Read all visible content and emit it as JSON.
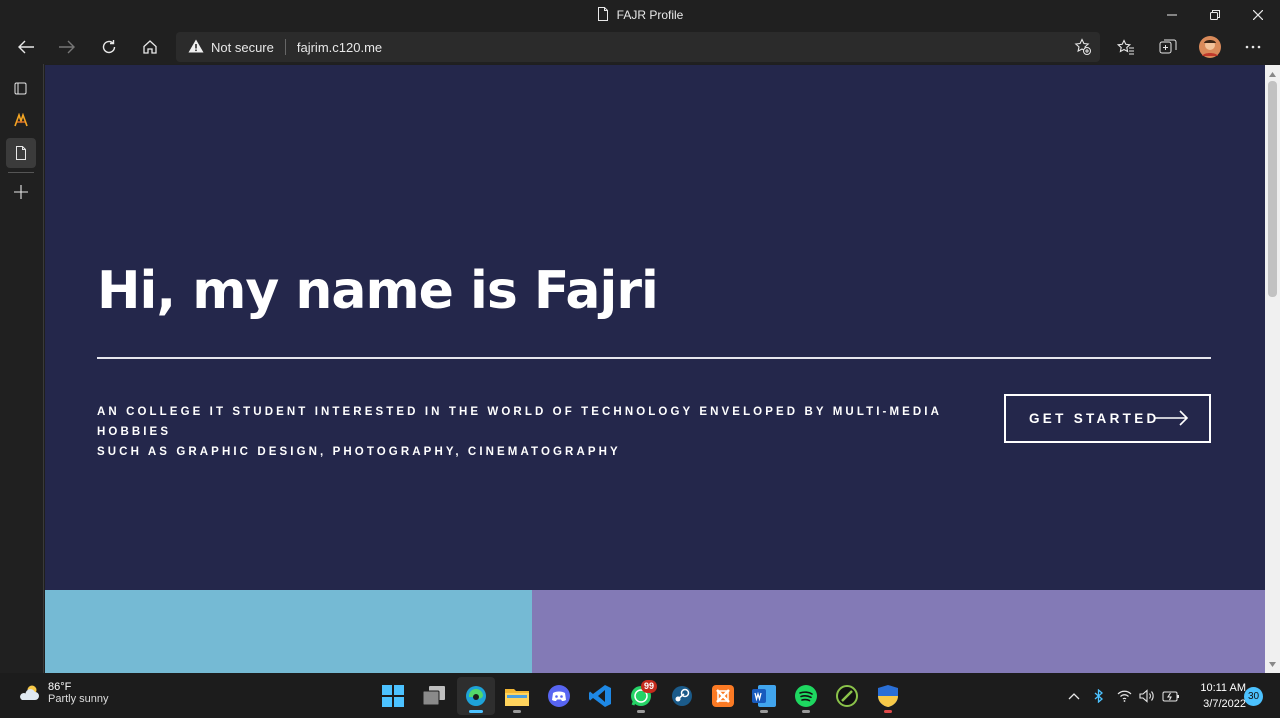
{
  "window": {
    "title": "FAJR Profile"
  },
  "address_bar": {
    "security_label": "Not secure",
    "url": "fajrim.c120.me"
  },
  "hero": {
    "title": "Hi, my name is Fajri",
    "description_line1": "AN COLLEGE IT STUDENT INTERESTED IN THE WORLD OF TECHNOLOGY ENVELOPED BY MULTI-MEDIA HOBBIES",
    "description_line2": "SUCH AS GRAPHIC DESIGN, PHOTOGRAPHY, CINEMATOGRAPHY",
    "cta_label": "GET STARTED"
  },
  "colors": {
    "hero_bg": "#24274b",
    "panel_blue": "#75bad4",
    "panel_purple": "#837ab6",
    "accent": "#4cc2ff"
  },
  "taskbar": {
    "weather_temp": "86°F",
    "weather_desc": "Partly sunny",
    "whatsapp_badge": "99",
    "time": "10:11 AM",
    "date": "3/7/2022",
    "notification_count": "30",
    "apps": [
      "start-icon",
      "task-view-icon",
      "edge-icon",
      "file-explorer-icon",
      "discord-icon",
      "vscode-icon",
      "whatsapp-icon",
      "steam-icon",
      "xampp-icon",
      "word-icon",
      "spotify-icon",
      "app-icon",
      "security-shield-icon"
    ]
  }
}
